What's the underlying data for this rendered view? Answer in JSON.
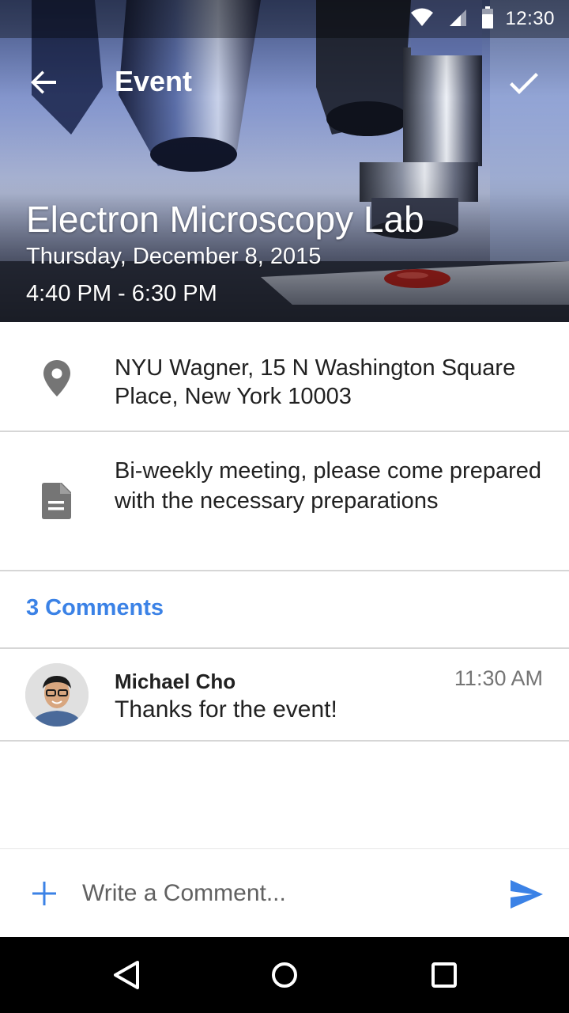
{
  "status_bar": {
    "time": "12:30",
    "icons": [
      "wifi-icon",
      "cell-signal-icon",
      "battery-icon"
    ]
  },
  "app_bar": {
    "back_icon": "arrow-back-icon",
    "title": "Event",
    "confirm_icon": "check-icon"
  },
  "event": {
    "title": "Electron Microscopy Lab",
    "date": "Thursday, December 8, 2015",
    "time_range": "4:40 PM - 6:30 PM",
    "hero_image": "microscope-photo"
  },
  "details": {
    "location": {
      "icon": "location-pin-icon",
      "text": "NYU Wagner, 15 N Washington Square Place, New York 10003"
    },
    "notes": {
      "icon": "document-icon",
      "text": "Bi-weekly meeting, please come prepared with the necessary preparations"
    }
  },
  "comments": {
    "count_label": "3 Comments",
    "items": [
      {
        "author": "Michael Cho",
        "time": "11:30 AM",
        "text": "Thanks for the event!",
        "avatar": "avatar-photo"
      }
    ]
  },
  "composer": {
    "add_icon": "plus-icon",
    "placeholder": "Write a Comment...",
    "send_icon": "send-icon"
  },
  "nav_bar": {
    "buttons": [
      "nav-back-icon",
      "nav-home-icon",
      "nav-recent-icon"
    ]
  },
  "colors": {
    "accent": "#3b82e6",
    "text_primary": "#212121",
    "text_secondary": "#757575",
    "divider": "#d6d6d6",
    "nav_bar": "#000000"
  }
}
